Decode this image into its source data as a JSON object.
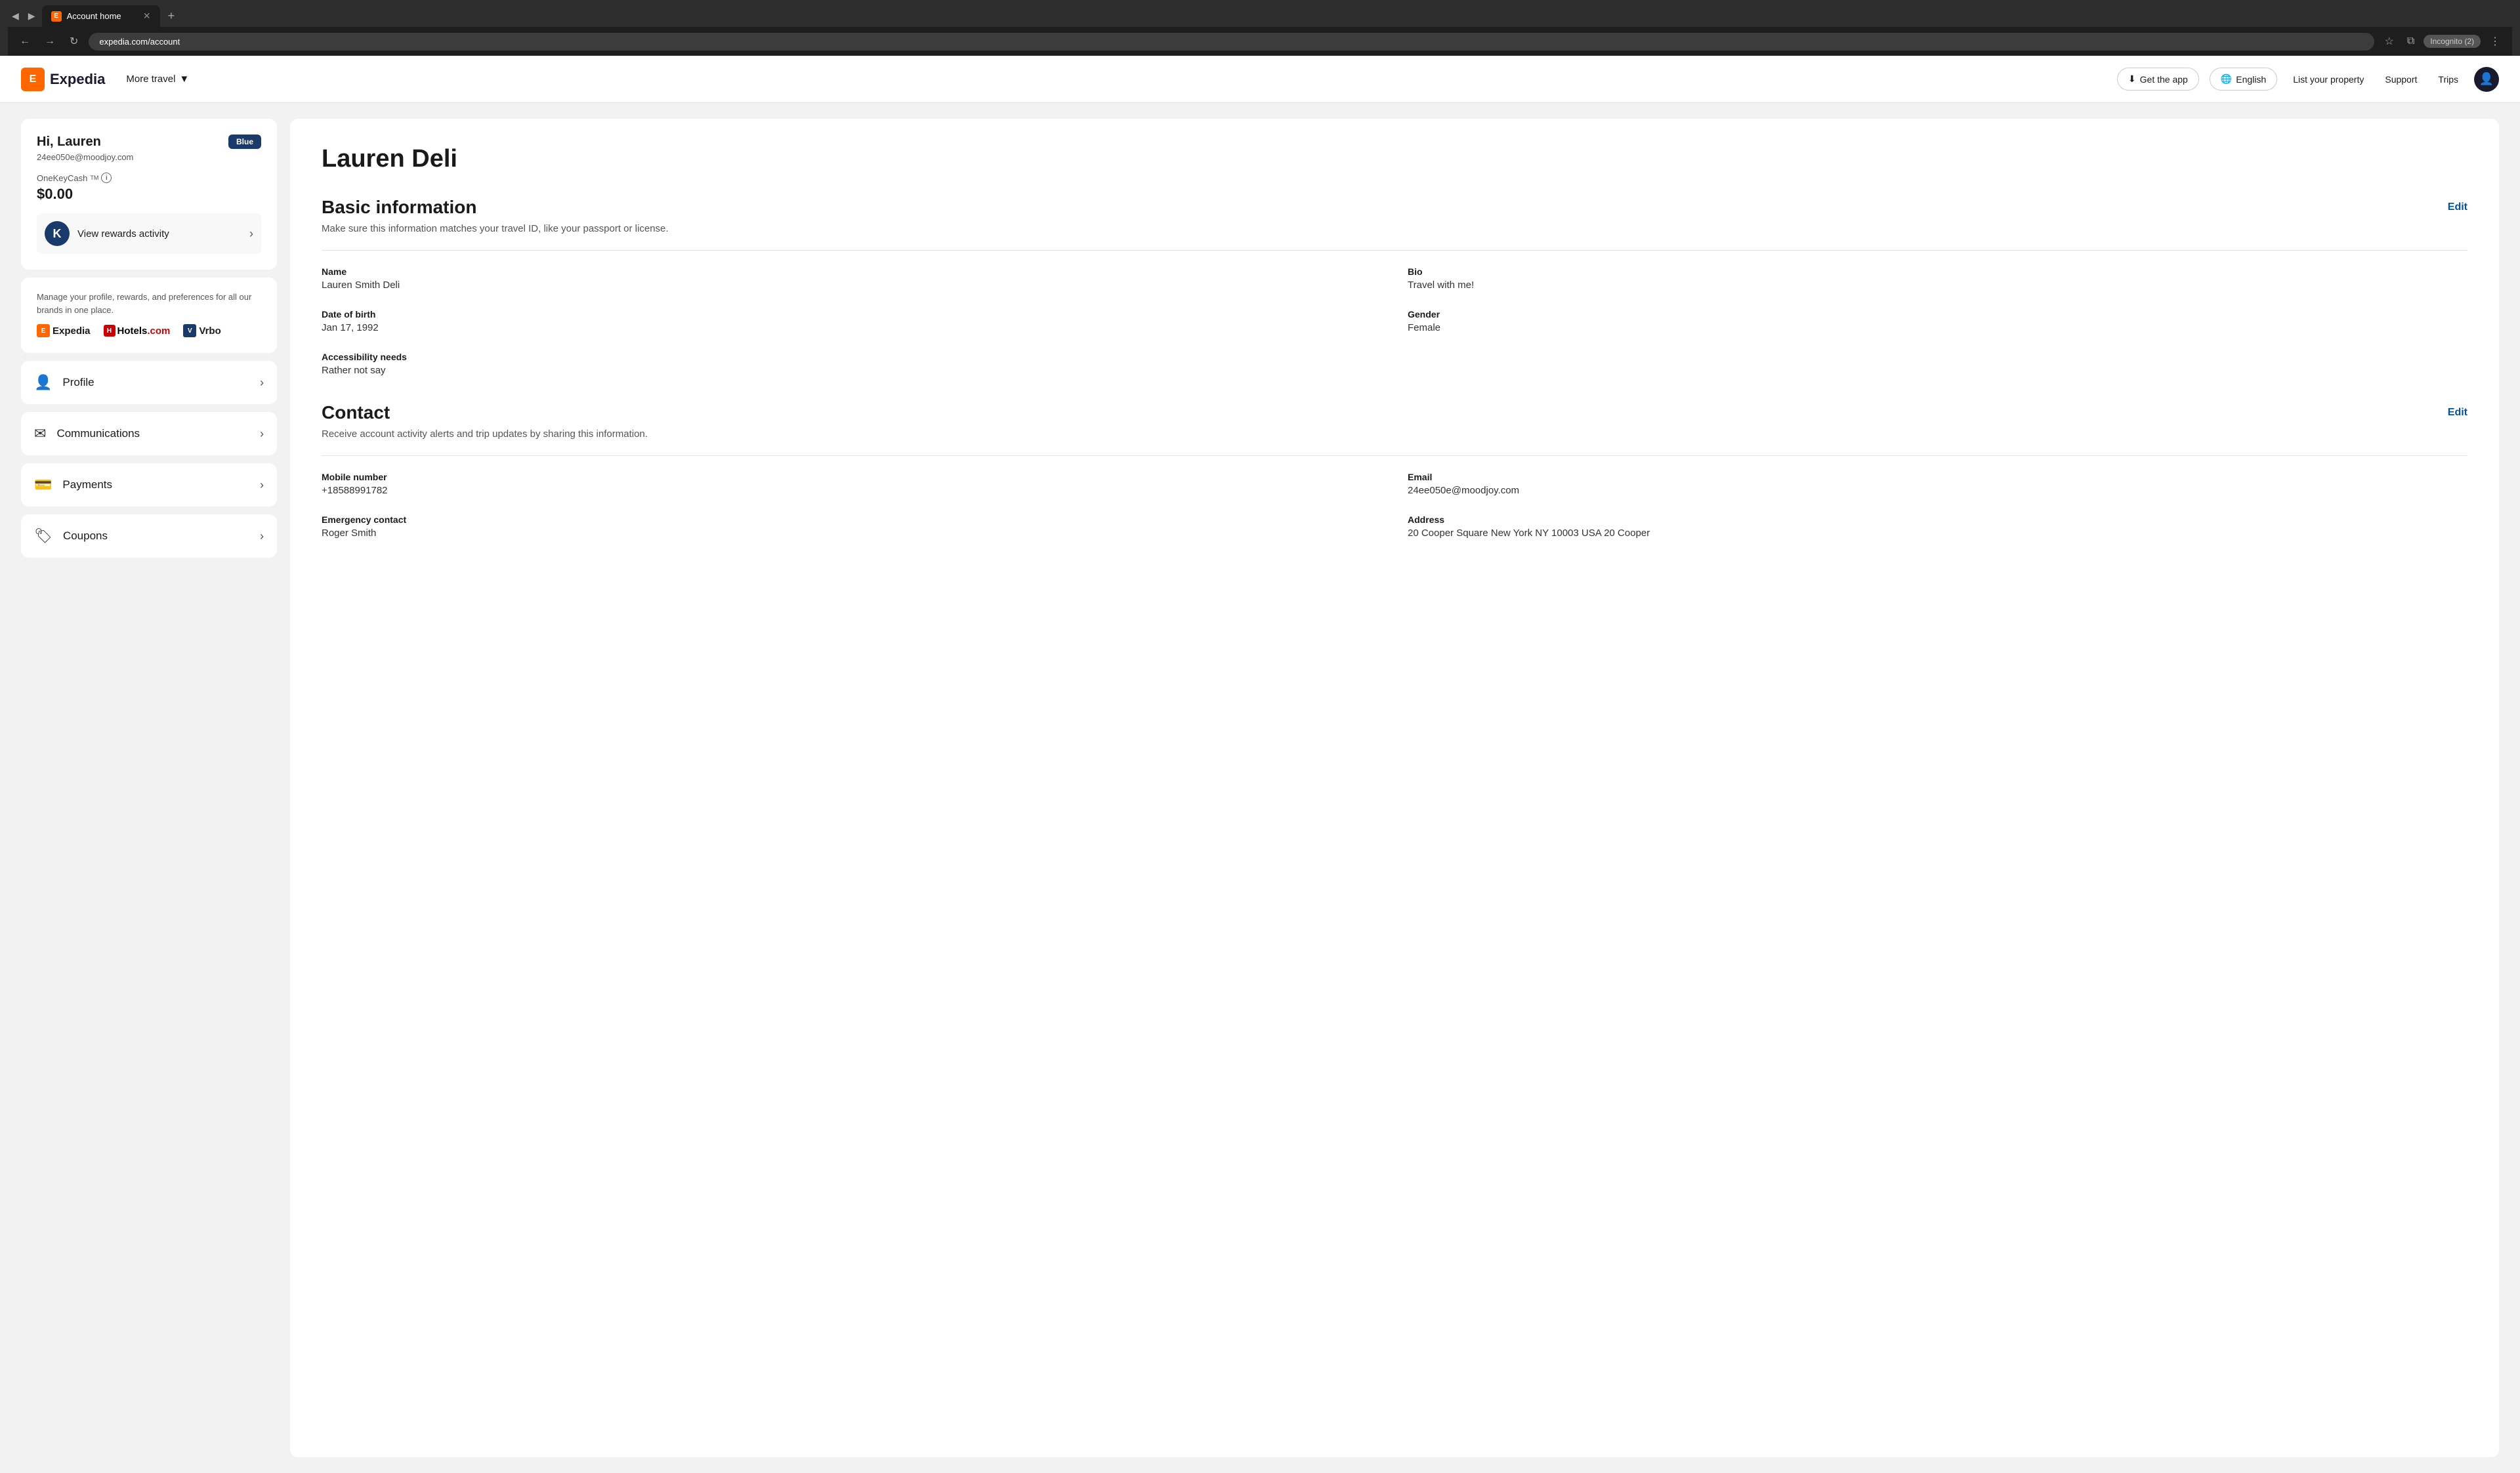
{
  "browser": {
    "tab_label": "Account home",
    "tab_favicon": "E",
    "url": "expedia.com/account",
    "incognito_label": "Incognito (2)"
  },
  "header": {
    "logo_text": "Expedia",
    "logo_icon": "E",
    "nav_more_label": "More travel",
    "get_app_label": "Get the app",
    "language_label": "English",
    "list_property_label": "List your property",
    "support_label": "Support",
    "trips_label": "Trips"
  },
  "sidebar": {
    "greeting": "Hi, Lauren",
    "email": "24ee050e@moodjoy.com",
    "tier_badge": "Blue",
    "onekey_label": "OneKeyCash",
    "tm_label": "TM",
    "cash_amount": "$0.00",
    "rewards_label": "View rewards activity",
    "manage_text": "Manage your profile, rewards, and preferences for all our brands in one place.",
    "brands": [
      {
        "name": "Expedia",
        "icon": "E"
      },
      {
        "name": "Hotels.com",
        "icon": "H"
      },
      {
        "name": "Vrbo",
        "icon": "V"
      }
    ],
    "nav_items": [
      {
        "label": "Profile",
        "icon": "👤"
      },
      {
        "label": "Communications",
        "icon": "✉"
      },
      {
        "label": "Payments",
        "icon": "💳"
      },
      {
        "label": "Coupons",
        "icon": "🏷"
      }
    ]
  },
  "main": {
    "profile_name": "Lauren Deli",
    "basic_info": {
      "section_title": "Basic information",
      "section_desc": "Make sure this information matches your travel ID, like your passport or license.",
      "edit_label": "Edit",
      "fields": [
        {
          "label": "Name",
          "value": "Lauren Smith Deli"
        },
        {
          "label": "Bio",
          "value": "Travel with me!"
        },
        {
          "label": "Date of birth",
          "value": "Jan 17, 1992"
        },
        {
          "label": "Gender",
          "value": "Female"
        },
        {
          "label": "Accessibility needs",
          "value": "Rather not say"
        }
      ]
    },
    "contact": {
      "section_title": "Contact",
      "section_desc": "Receive account activity alerts and trip updates by sharing this information.",
      "edit_label": "Edit",
      "fields": [
        {
          "label": "Mobile number",
          "value": "+18588991782"
        },
        {
          "label": "Email",
          "value": "24ee050e@moodjoy.com"
        },
        {
          "label": "Emergency contact",
          "value": "Roger Smith"
        },
        {
          "label": "Address",
          "value": "20 Cooper Square New York NY 10003 USA 20 Cooper"
        }
      ]
    }
  }
}
